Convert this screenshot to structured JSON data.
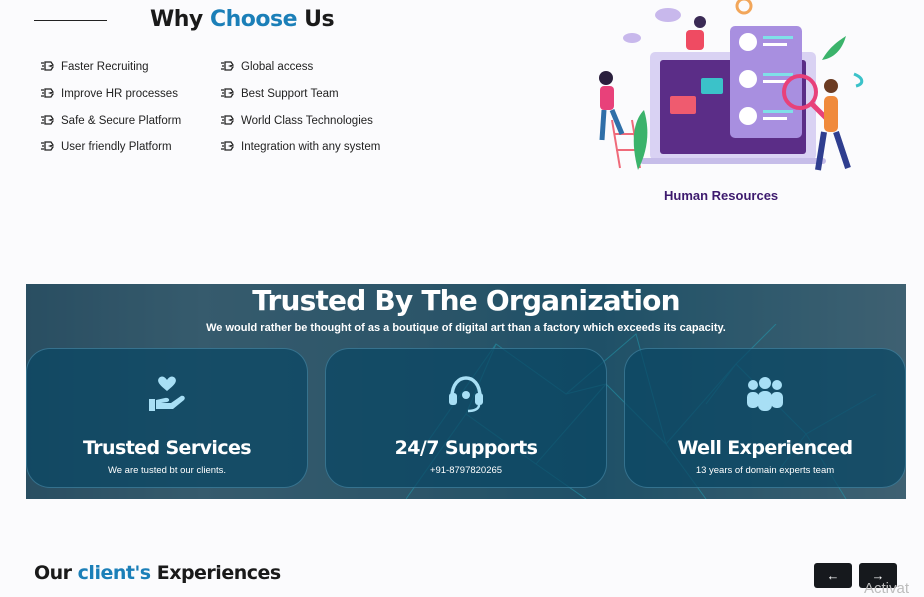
{
  "why": {
    "title_prefix": "Why ",
    "title_accent": "Choose",
    "title_suffix": " Us",
    "features": [
      "Faster Recruiting",
      "Improve HR processes",
      "Safe & Secure Platform",
      "User friendly Platform",
      "Global access",
      "Best Support Team",
      "World Class Technologies",
      "Integration with any system"
    ]
  },
  "illustration": {
    "caption": "Human Resources"
  },
  "trusted": {
    "title": "Trusted By The Organization",
    "subtitle": "We would rather be thought of as a boutique of digital art than a factory which exceeds its capacity.",
    "cards": [
      {
        "icon": "hand-heart-icon",
        "title": "Trusted Services",
        "text": "We are tusted bt our clients."
      },
      {
        "icon": "headset-icon",
        "title": "24/7 Supports",
        "text": "+91-8797820265"
      },
      {
        "icon": "users-group-icon",
        "title": "Well Experienced",
        "text": "13 years of domain experts team"
      }
    ]
  },
  "clients": {
    "title_prefix": "Our ",
    "title_accent": "client's",
    "title_suffix": " Experiences",
    "prev_label": "←",
    "next_label": "→"
  },
  "watermark": "Activat",
  "colors": {
    "accent": "#1b7fb8",
    "card_bg": "#0a4664",
    "icon": "#a8dff5",
    "caption": "#3d1a6e"
  }
}
